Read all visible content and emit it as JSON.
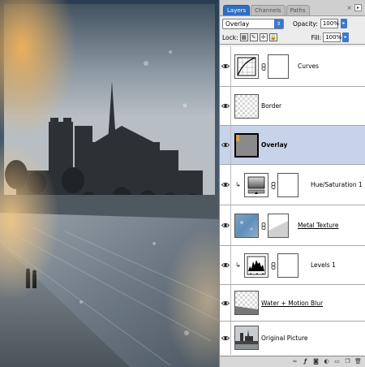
{
  "canvas": {
    "image": "photo-notre-dame-seine-texture"
  },
  "palette": {
    "tabs": [
      "Layers",
      "Channels",
      "Paths"
    ],
    "active_tab": "Layers",
    "blend_mode": "Overlay",
    "opacity_label": "Opacity:",
    "opacity_value": "100%",
    "lock_label": "Lock:",
    "fill_label": "Fill:",
    "fill_value": "100%"
  },
  "layers": [
    {
      "name": "Curves",
      "kind": "adjustment-curves",
      "has_mask": true,
      "clipped": false,
      "selected": false
    },
    {
      "name": "Border",
      "kind": "transparent",
      "has_mask": false,
      "clipped": false,
      "selected": false
    },
    {
      "name": "Overlay",
      "kind": "gray-fill",
      "has_mask": false,
      "clipped": false,
      "selected": true
    },
    {
      "name": "Hue/Saturation 1",
      "kind": "adjustment-hue",
      "has_mask": true,
      "clipped": true,
      "selected": false
    },
    {
      "name": "Metal Texture",
      "kind": "metal",
      "has_mask": true,
      "clipped": false,
      "selected": false
    },
    {
      "name": "Levels 1",
      "kind": "adjustment-levels",
      "has_mask": true,
      "clipped": true,
      "selected": false
    },
    {
      "name": "Water + Motion Blur",
      "kind": "water",
      "has_mask": false,
      "clipped": false,
      "selected": false
    },
    {
      "name": "Original Picture",
      "kind": "photo",
      "has_mask": false,
      "clipped": false,
      "selected": false
    }
  ],
  "colors": {
    "accent": "#2f6fc2",
    "selected_row": "#c7d3e8",
    "metal_blue": "#5f8fb8"
  }
}
